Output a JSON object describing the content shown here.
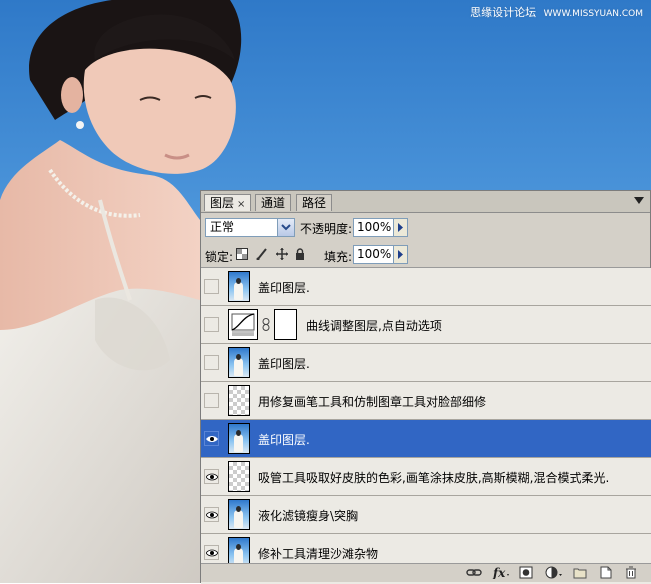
{
  "watermark": {
    "site_cn": "思缘设计论坛",
    "site_url": "WWW.MISSYUAN.COM"
  },
  "panel": {
    "tabs": [
      {
        "label": "图层",
        "close": "×",
        "active": true
      },
      {
        "label": "通道",
        "active": false
      },
      {
        "label": "路径",
        "active": false
      }
    ],
    "blend_mode": "正常",
    "opacity_label": "不透明度:",
    "opacity_value": "100%",
    "lock_label": "锁定:",
    "fill_label": "填充:",
    "fill_value": "100%",
    "layers": [
      {
        "name": "盖印图层.",
        "visible": false,
        "thumb": "image",
        "selected": false
      },
      {
        "name": "曲线调整图层,点自动选项",
        "visible": false,
        "thumb": "curves-adjustment",
        "selected": false
      },
      {
        "name": "盖印图层.",
        "visible": false,
        "thumb": "image",
        "selected": false
      },
      {
        "name": "用修复画笔工具和仿制图章工具对脸部细修",
        "visible": false,
        "thumb": "transparent",
        "selected": false
      },
      {
        "name": "盖印图层.",
        "visible": true,
        "thumb": "image",
        "selected": true
      },
      {
        "name": "吸管工具吸取好皮肤的色彩,画笔涂抹皮肤,高斯模糊,混合模式柔光.",
        "visible": true,
        "thumb": "transparent",
        "selected": false
      },
      {
        "name": "液化滤镜瘦身\\突胸",
        "visible": true,
        "thumb": "image",
        "selected": false
      },
      {
        "name": "修补工具清理沙滩杂物",
        "visible": true,
        "thumb": "image",
        "selected": false
      }
    ],
    "footer_icons": [
      "link-icon",
      "fx-icon",
      "add-mask-icon",
      "adjustment-layer-icon",
      "new-group-icon",
      "new-layer-icon",
      "trash-icon"
    ]
  },
  "colors": {
    "selected_row": "#3166c4",
    "panel_bg": "#d4d0c8",
    "sky": "#4f98dc"
  }
}
